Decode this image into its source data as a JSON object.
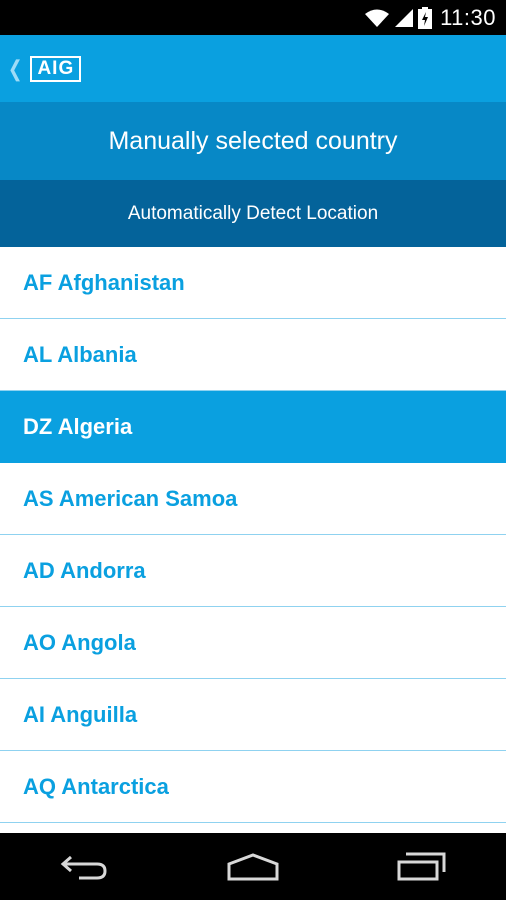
{
  "status_bar": {
    "time": "11:30",
    "icons": [
      "wifi-icon",
      "signal-icon",
      "battery-charging-icon"
    ]
  },
  "app_bar": {
    "back_icon": "chevron-left-icon",
    "logo_text": "AIG"
  },
  "header": {
    "title": "Manually selected country",
    "auto_detect_label": "Automatically Detect Location"
  },
  "countries": [
    {
      "label": "AF Afghanistan",
      "selected": false
    },
    {
      "label": "AL Albania",
      "selected": false
    },
    {
      "label": "DZ Algeria",
      "selected": true
    },
    {
      "label": "AS American Samoa",
      "selected": false
    },
    {
      "label": "AD Andorra",
      "selected": false
    },
    {
      "label": "AO Angola",
      "selected": false
    },
    {
      "label": "AI Anguilla",
      "selected": false
    },
    {
      "label": "AQ Antarctica",
      "selected": false
    }
  ],
  "nav_bar": {
    "icons": [
      "back-nav-icon",
      "home-nav-icon",
      "recents-nav-icon"
    ]
  },
  "colors": {
    "app_bar": "#0aa0e0",
    "title_band": "#0788c6",
    "auto_band": "#04639a",
    "accent_text": "#0aa0e0",
    "divider": "#8fd2f0"
  }
}
